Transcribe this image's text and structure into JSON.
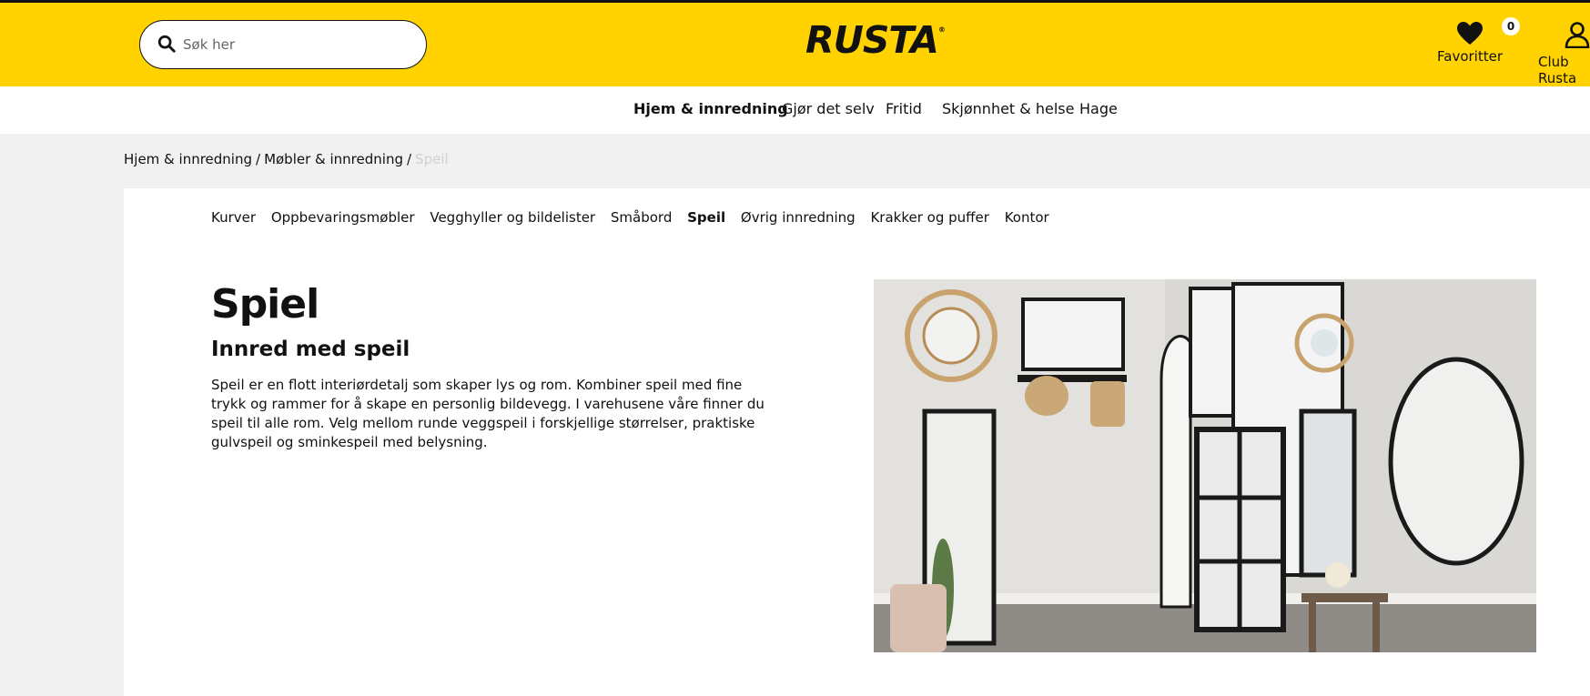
{
  "search": {
    "placeholder": "Søk her",
    "icon": "search-icon"
  },
  "brand": {
    "logo_text": "RUSTA",
    "registered_mark": "®",
    "header_color": "#ffd200"
  },
  "favorites": {
    "label": "Favoritter",
    "count": "0",
    "icon": "heart-icon"
  },
  "account": {
    "label": "Club Rusta",
    "icon": "user-icon"
  },
  "main_nav": [
    {
      "label": "Hjem & innredning",
      "active": true
    },
    {
      "label": "Gjør det selv",
      "active": false
    },
    {
      "label": "Fritid",
      "active": false
    },
    {
      "label": "Skjønnhet & helse",
      "active": false
    },
    {
      "label": "Hage",
      "active": false
    }
  ],
  "breadcrumb": {
    "items": [
      "Hjem & innredning",
      "Møbler & innredning"
    ],
    "separator": "/",
    "current": "Speil"
  },
  "sub_nav": [
    {
      "label": "Kurver",
      "active": false
    },
    {
      "label": "Oppbevaringsmøbler",
      "active": false
    },
    {
      "label": "Vegghyller og bildelister",
      "active": false
    },
    {
      "label": "Småbord",
      "active": false
    },
    {
      "label": "Speil",
      "active": true
    },
    {
      "label": "Øvrig innredning",
      "active": false
    },
    {
      "label": "Krakker og puffer",
      "active": false
    },
    {
      "label": "Kontor",
      "active": false
    }
  ],
  "page": {
    "title": "Spiel",
    "subtitle": "Innred med speil",
    "description": "Speil er en flott interiørdetalj som skaper lys og rom. Kombiner speil med fine trykk og rammer for å skape en personlig bildevegg. I varehusene våre finner du speil til alle rom. Velg mellom runde veggspeil i forskjellige størrelser, praktiske gulvspeil og sminkespeil med belysning."
  }
}
